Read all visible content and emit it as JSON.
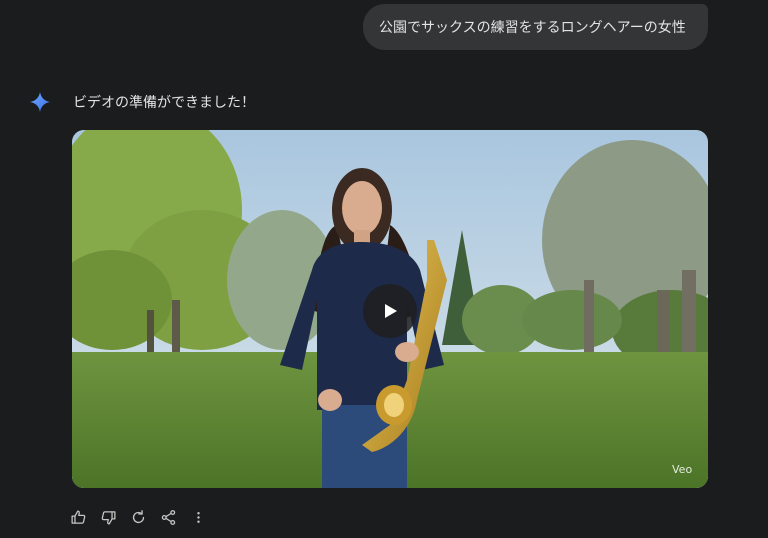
{
  "conversation": {
    "user_prompt": "公園でサックスの練習をするロングヘアーの女性",
    "assistant_reply": "ビデオの準備ができました！",
    "assistant_icon": "gemini-spark-icon"
  },
  "video": {
    "watermark": "Veo",
    "play_icon": "play-icon"
  },
  "actions": [
    {
      "name": "thumbs-up-icon"
    },
    {
      "name": "thumbs-down-icon"
    },
    {
      "name": "regenerate-icon"
    },
    {
      "name": "share-icon"
    },
    {
      "name": "more-options-icon"
    }
  ],
  "colors": {
    "background": "#1b1c1d",
    "bubble": "#333537",
    "spark": "#4f8df7"
  }
}
